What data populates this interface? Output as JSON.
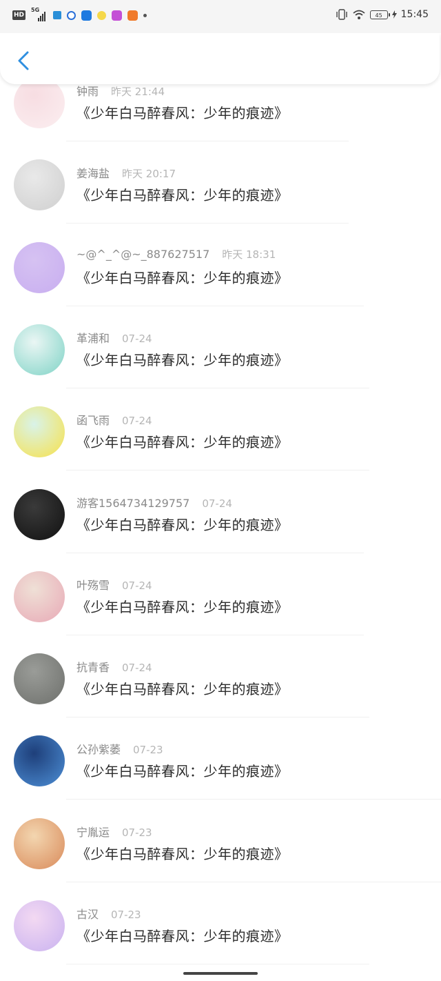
{
  "status_bar": {
    "hd": "HD",
    "network": "5G",
    "battery": "45",
    "time": "15:45"
  },
  "header": {
    "back_icon": "chevron-left-icon",
    "accent": "#2f8fe0"
  },
  "comments": [
    {
      "user": "钟雨",
      "time": "昨天 21:44",
      "title": "《少年白马醉春风：少年的痕迹》",
      "avatar_colors": [
        "#f7dde2",
        "#fbeef0"
      ]
    },
    {
      "user": "姜海盐",
      "time": "昨天 20:17",
      "title": "《少年白马醉春风：少年的痕迹》",
      "avatar_colors": [
        "#e9e9e9",
        "#cfcfcf"
      ]
    },
    {
      "user": "~@^_^@~_887627517",
      "time": "昨天 18:31",
      "title": "《少年白马醉春风：少年的痕迹》",
      "avatar_colors": [
        "#d6c2f2",
        "#c8aef0"
      ]
    },
    {
      "user": "革浦和",
      "time": "07-24",
      "title": "《少年白马醉春风：少年的痕迹》",
      "avatar_colors": [
        "#eaf6f4",
        "#7fd3c6"
      ]
    },
    {
      "user": "函飞雨",
      "time": "07-24",
      "title": "《少年白马醉春风：少年的痕迹》",
      "avatar_colors": [
        "#d9f3e9",
        "#f7e14a"
      ]
    },
    {
      "user": "游客1564734129757",
      "time": "07-24",
      "title": "《少年白马醉春风：少年的痕迹》",
      "avatar_colors": [
        "#3a3a3a",
        "#111111"
      ]
    },
    {
      "user": "叶殇雪",
      "time": "07-24",
      "title": "《少年白马醉春风：少年的痕迹》",
      "avatar_colors": [
        "#efe0d6",
        "#e8a9b6"
      ]
    },
    {
      "user": "抗青香",
      "time": "07-24",
      "title": "《少年白马醉春风：少年的痕迹》",
      "avatar_colors": [
        "#9a9c98",
        "#6e706c"
      ]
    },
    {
      "user": "公孙紫萎",
      "time": "07-23",
      "title": "《少年白马醉春风：少年的痕迹》",
      "avatar_colors": [
        "#1e3f7a",
        "#4d8fd6"
      ]
    },
    {
      "user": "宁胤运",
      "time": "07-23",
      "title": "《少年白马醉春风：少年的痕迹》",
      "avatar_colors": [
        "#f3d6b0",
        "#d98a5a"
      ]
    },
    {
      "user": "古汉",
      "time": "07-23",
      "title": "《少年白马醉春风：少年的痕迹》",
      "avatar_colors": [
        "#f3d9f2",
        "#c9b2f0"
      ]
    }
  ]
}
